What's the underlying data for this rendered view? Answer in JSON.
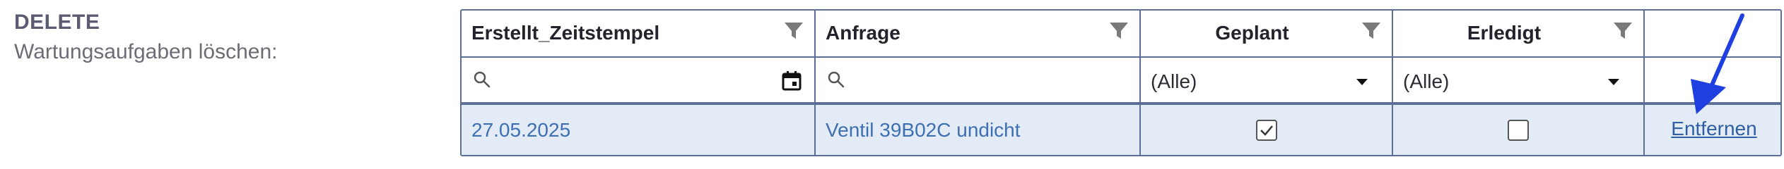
{
  "section": {
    "title": "DELETE",
    "subtitle": "Wartungsaufgaben löschen:"
  },
  "grid": {
    "columns": [
      {
        "label": "Erstellt_Zeitstempel"
      },
      {
        "label": "Anfrage"
      },
      {
        "label": "Geplant"
      },
      {
        "label": "Erledigt"
      },
      {
        "label": ""
      }
    ],
    "filters": {
      "geplant_value": "(Alle)",
      "erledigt_value": "(Alle)"
    },
    "rows": [
      {
        "erstellt_zeitstempel": "27.05.2025",
        "anfrage": "Ventil 39B02C undicht",
        "geplant": true,
        "erledigt": false,
        "action_label": "Entfernen"
      }
    ]
  },
  "colors": {
    "accent": "#1f3fe0",
    "border": "#5b6f97",
    "row_bg": "#e2ebf6",
    "link": "#2f5fa3"
  }
}
